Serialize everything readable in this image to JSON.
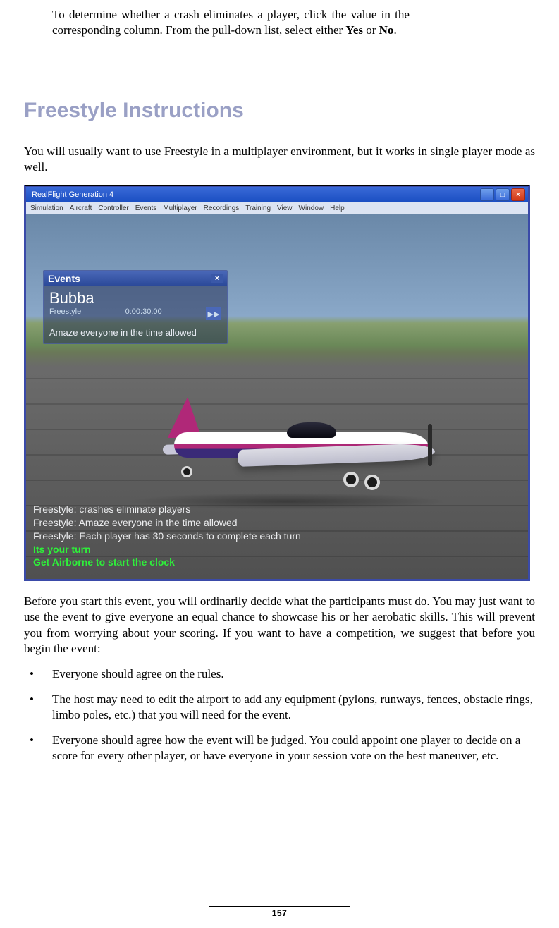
{
  "intro": {
    "line1": "To determine whether a crash eliminates a player, click the value in the",
    "line2a": "corresponding column.  From the pull-down list, select either ",
    "bold1": "Yes",
    "or": " or ",
    "bold2": "No",
    "period": "."
  },
  "heading": "Freestyle Instructions",
  "para1": "You will usually want to use Freestyle in a multiplayer environment, but it works in single player mode as well.",
  "screenshot": {
    "window_title": "RealFlight Generation 4",
    "window_buttons": {
      "min": "–",
      "max": "□",
      "close": "×"
    },
    "menu_items": [
      "Simulation",
      "Aircraft",
      "Controller",
      "Events",
      "Multiplayer",
      "Recordings",
      "Training",
      "View",
      "Window",
      "Help"
    ],
    "events_panel": {
      "title": "Events",
      "close": "×",
      "player_name": "Bubba",
      "mode": "Freestyle",
      "timer": "0:00:30.00",
      "play_glyph": "▶▶",
      "message": "Amaze everyone in the time allowed"
    },
    "status_lines": {
      "l1": "Freestyle: crashes eliminate players",
      "l2": "Freestyle: Amaze everyone in the time allowed",
      "l3": "Freestyle: Each player has 30 seconds to complete each turn",
      "g1": "Its your turn",
      "g2": "Get Airborne to start the clock"
    }
  },
  "para2": "Before you start this event, you will ordinarily decide what the participants must do.  You may just want to use the event to give everyone an equal chance to showcase his or her aerobatic skills.  This will prevent you from worrying about your scoring.  If you want to have a competition, we suggest that before you begin the event:",
  "bullets": [
    "Everyone should agree on the rules.",
    "The host may need to edit the airport to add any equipment (pylons, runways, fences, obstacle rings, limbo poles, etc.) that you will need for the event.",
    "Everyone should agree how the event will be judged.  You could appoint one player to decide on a score for every other player, or have everyone in your session vote on the best maneuver, etc."
  ],
  "page_number": "157"
}
